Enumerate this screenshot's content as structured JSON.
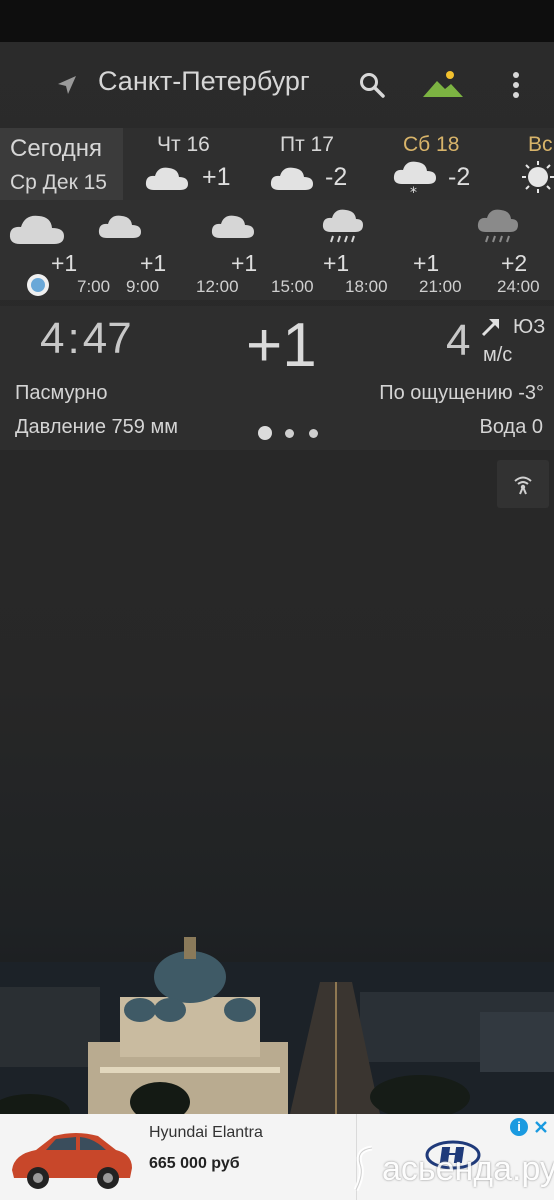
{
  "header": {
    "city": "Санкт-Петербург",
    "location_icon": "navigation-arrow-icon",
    "search_icon": "search-icon",
    "wallpaper_icon": "landscape-icon",
    "menu_icon": "more-vert-icon"
  },
  "days": [
    {
      "label": "Сегодня",
      "sub": "Ср Дек 15"
    },
    {
      "label": "Чт 16",
      "temp": "+1",
      "icon": "cloud-icon"
    },
    {
      "label": "Пт 17",
      "temp": "-2",
      "icon": "cloud-icon"
    },
    {
      "label": "Сб 18",
      "temp": "-2",
      "icon": "cloud-snow-icon",
      "color": "#d8b46a"
    },
    {
      "label": "Вс",
      "icon": "sun-icon",
      "color": "#d8b46a"
    }
  ],
  "hourly": {
    "temps": [
      "+1",
      "+1",
      "+1",
      "+1",
      "+1",
      "+2"
    ],
    "times": [
      "7:00",
      "9:00",
      "12:00",
      "15:00",
      "18:00",
      "21:00",
      "24:00"
    ]
  },
  "current": {
    "time_h": "4",
    "time_m": "47",
    "temp": "+1",
    "wind_speed": "4",
    "wind_dir": "ЮЗ",
    "wind_unit": "м/с",
    "condition": "Пасмурно",
    "feels_like": "По ощущению -3°",
    "pressure": "Давление 759 мм",
    "water": "Вода 0"
  },
  "ad": {
    "title": "Hyundai Elantra",
    "price": "665 000 руб",
    "watermark": "асьенда.ру"
  },
  "colors": {
    "accent_weekend": "#d8b46a",
    "dot": "#6aa8d8",
    "mountain": "#7cb342",
    "sun": "#f2c12e"
  }
}
